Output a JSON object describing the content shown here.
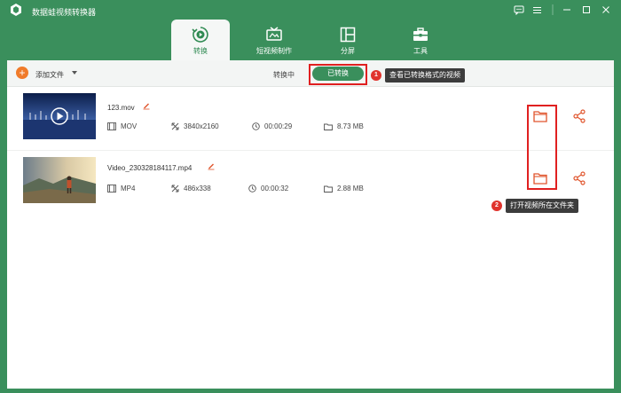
{
  "app": {
    "title": "数据蛙视频转换器"
  },
  "nav": {
    "tabs": [
      {
        "label": "转换",
        "icon": "convert-icon",
        "active": true
      },
      {
        "label": "短视频制作",
        "icon": "tv-icon",
        "active": false
      },
      {
        "label": "分屏",
        "icon": "split-screen-icon",
        "active": false
      },
      {
        "label": "工具",
        "icon": "toolbox-icon",
        "active": false
      }
    ]
  },
  "toolbar": {
    "add_label": "添加文件",
    "converting_label": "转换中",
    "converted_label": "已转换"
  },
  "annotations": {
    "marker1": "1",
    "callout1": "查看已转换格式的视频",
    "marker2": "2",
    "callout2": "打开视频所在文件夹"
  },
  "files": [
    {
      "name": "123.mov",
      "format": "MOV",
      "resolution": "3840x2160",
      "duration": "00:00:29",
      "size": "8.73 MB"
    },
    {
      "name": "Video_230328184117.mp4",
      "format": "MP4",
      "resolution": "486x338",
      "duration": "00:00:32",
      "size": "2.88 MB"
    }
  ],
  "colors": {
    "brand": "#3a8f5c",
    "accent": "#f07b2a",
    "highlight": "#e02020",
    "marker": "#e0332d"
  }
}
